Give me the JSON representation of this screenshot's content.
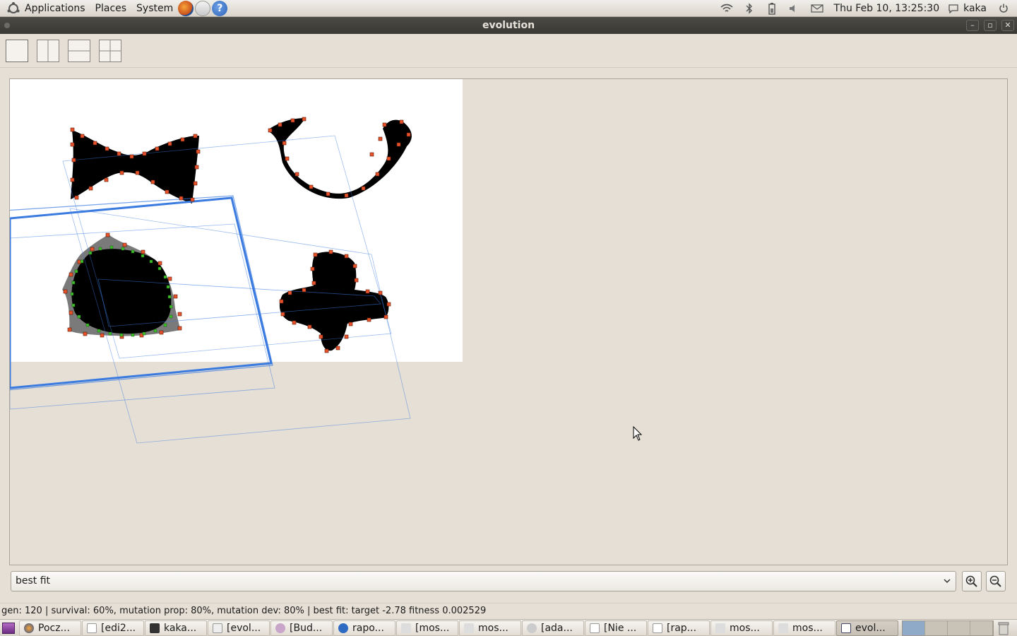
{
  "top_panel": {
    "menus": [
      "Applications",
      "Places",
      "System"
    ],
    "clock": "Thu Feb 10, 13:25:30",
    "user": "kaka"
  },
  "window": {
    "title": "evolution"
  },
  "toolbar": {
    "layouts": [
      "single-view",
      "split-vertical",
      "split-horizontal",
      "split-quad"
    ]
  },
  "zoom": {
    "selected": "best fit"
  },
  "status": {
    "text": "gen: 120 | survival: 60%, mutation prop: 80%, mutation dev: 80% | best fit: target -2.78 fitness 0.002529"
  },
  "taskbar": {
    "tasks": [
      {
        "label": "Pocz..."
      },
      {
        "label": "[edi2..."
      },
      {
        "label": "kaka..."
      },
      {
        "label": "[evol..."
      },
      {
        "label": "[Bud..."
      },
      {
        "label": "rapo..."
      },
      {
        "label": "[mos..."
      },
      {
        "label": "mos..."
      },
      {
        "label": "[ada..."
      },
      {
        "label": "[Nie ..."
      },
      {
        "label": "[rap..."
      },
      {
        "label": "mos..."
      },
      {
        "label": "mos..."
      },
      {
        "label": "evol..."
      }
    ]
  },
  "colors": {
    "shape_fill": "#000000",
    "control_point": "#e8532c",
    "matched_point": "#3fbf2a",
    "model_outline": "#3b7be0",
    "accent": "#8fa9c9"
  }
}
